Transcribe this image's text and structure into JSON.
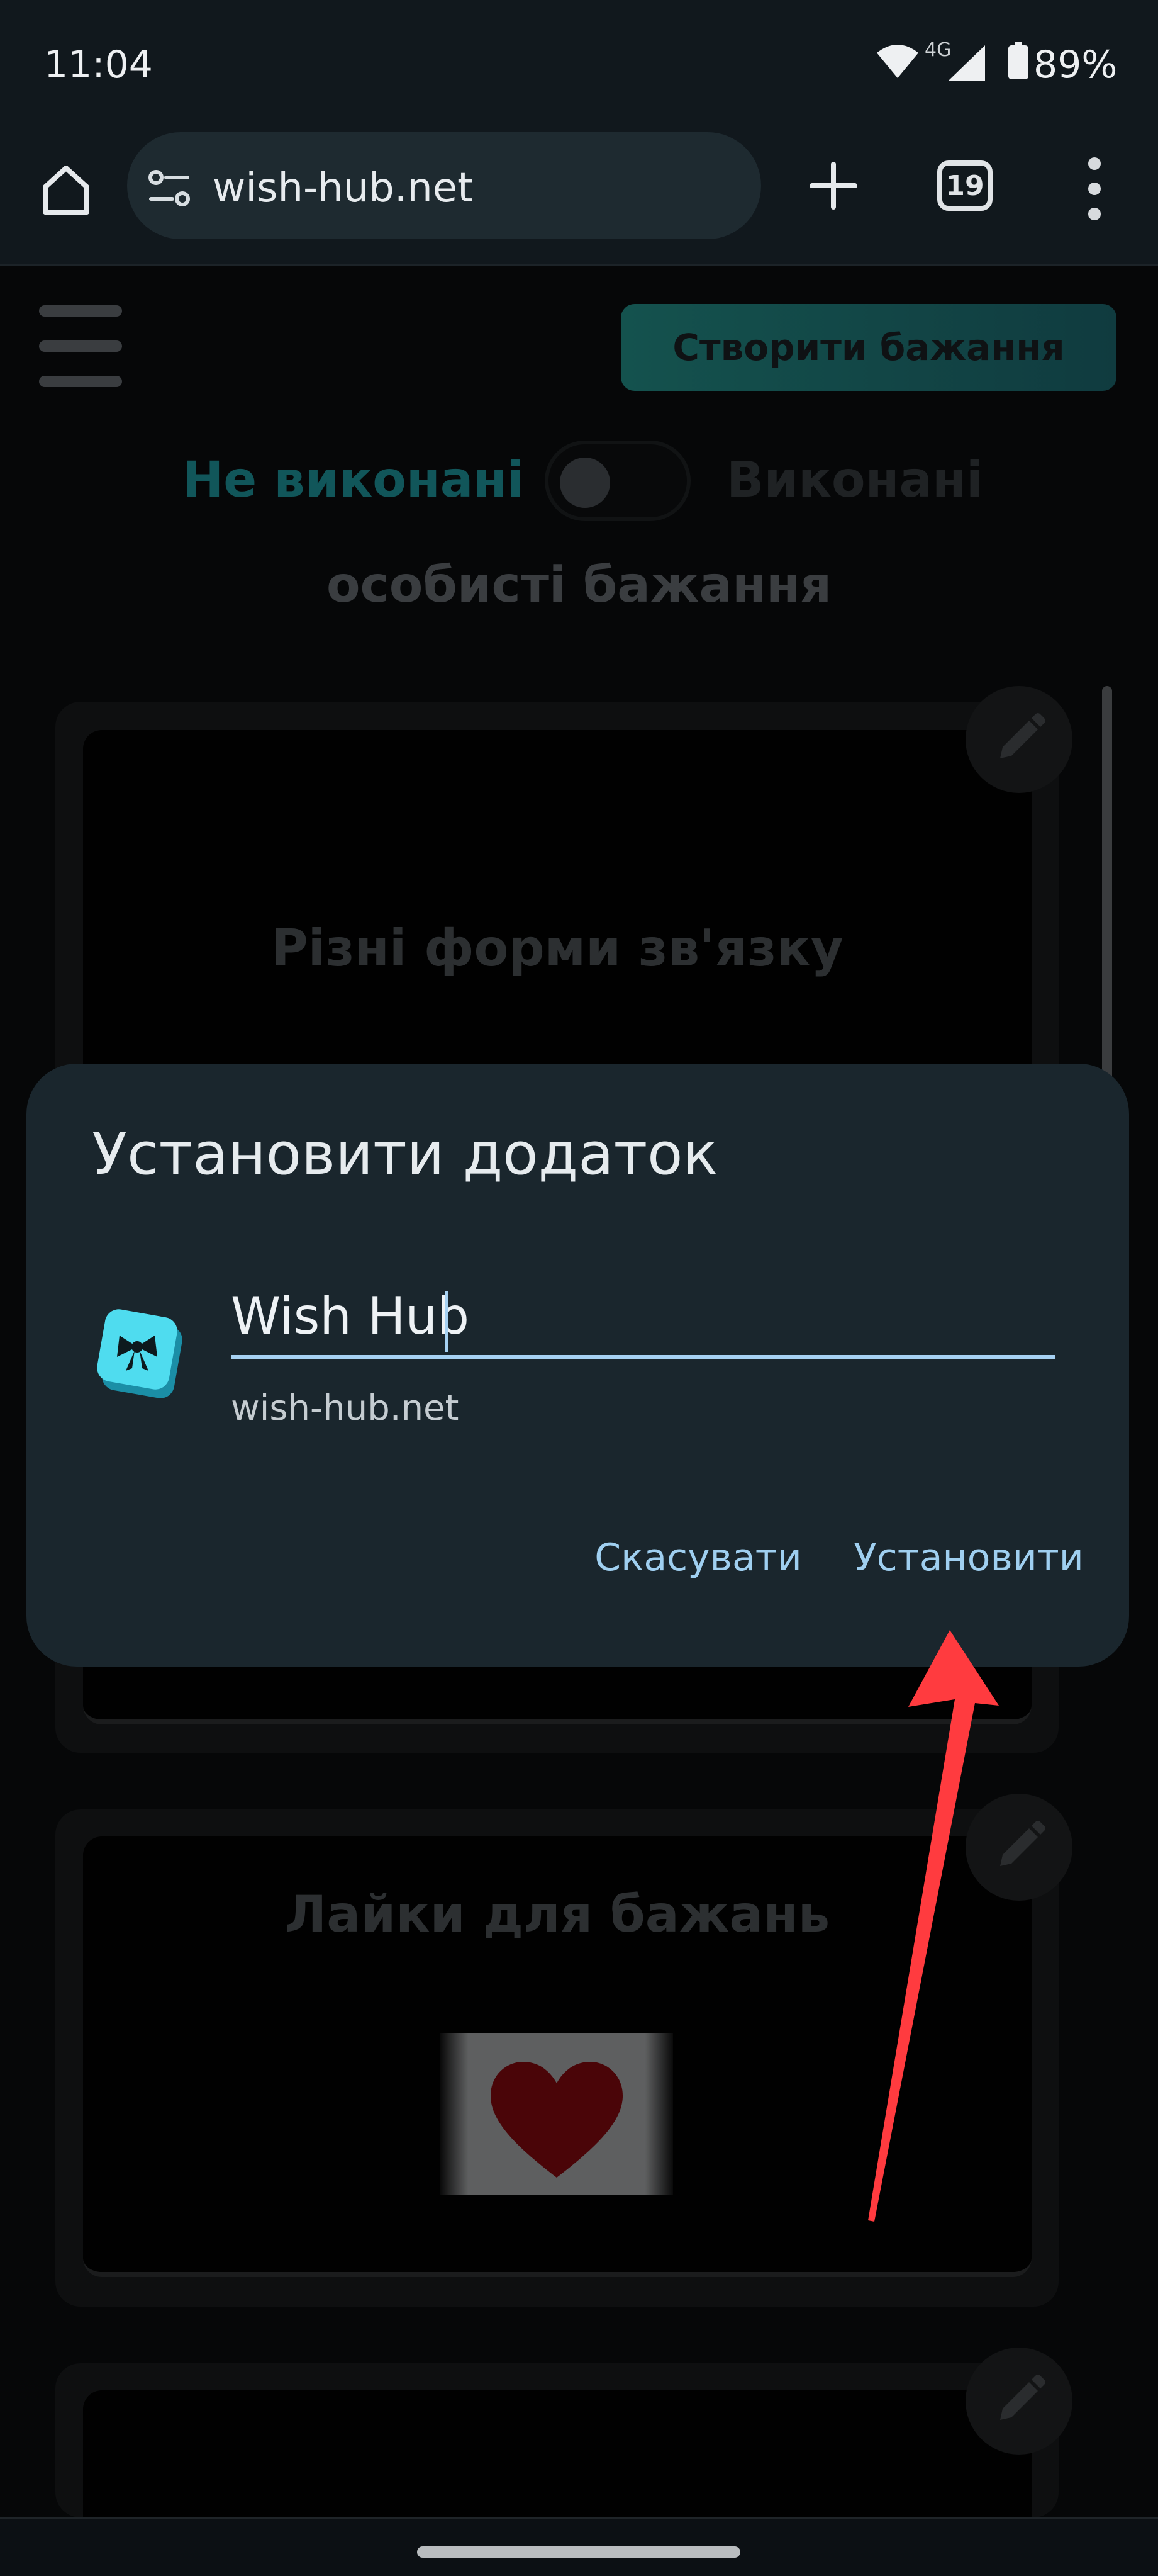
{
  "status_bar": {
    "time": "11:04",
    "network": "4G",
    "battery": "89%"
  },
  "browser": {
    "url": "wish-hub.net",
    "tab_count": "19"
  },
  "page": {
    "create_button": "Створити бажання",
    "tab_undone": "Не виконані",
    "tab_done": "Виконані",
    "section_title": "особисті бажання",
    "cards": [
      {
        "title": "Різні форми зв'язку"
      },
      {
        "title": "Лайки для бажань"
      },
      {
        "title": ""
      }
    ]
  },
  "dialog": {
    "title": "Установити додаток",
    "app_name": "Wish Hub",
    "app_url": "wish-hub.net",
    "cancel_label": "Скасувати",
    "install_label": "Установити"
  },
  "colors": {
    "accent": "#a6d1f2",
    "arrow": "#ff3b3f",
    "dialog_bg": "#1a262d"
  }
}
